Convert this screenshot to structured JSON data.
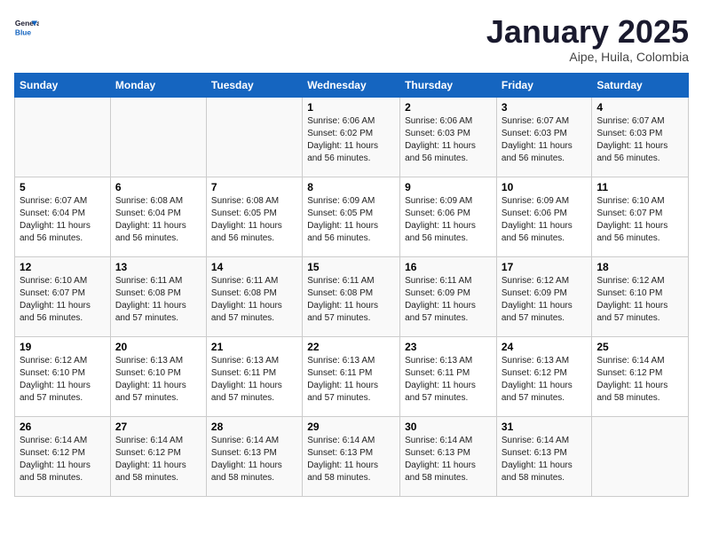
{
  "header": {
    "logo_line1": "General",
    "logo_line2": "Blue",
    "month": "January 2025",
    "location": "Aipe, Huila, Colombia"
  },
  "weekdays": [
    "Sunday",
    "Monday",
    "Tuesday",
    "Wednesday",
    "Thursday",
    "Friday",
    "Saturday"
  ],
  "weeks": [
    [
      {
        "day": "",
        "info": ""
      },
      {
        "day": "",
        "info": ""
      },
      {
        "day": "",
        "info": ""
      },
      {
        "day": "1",
        "info": "Sunrise: 6:06 AM\nSunset: 6:02 PM\nDaylight: 11 hours\nand 56 minutes."
      },
      {
        "day": "2",
        "info": "Sunrise: 6:06 AM\nSunset: 6:03 PM\nDaylight: 11 hours\nand 56 minutes."
      },
      {
        "day": "3",
        "info": "Sunrise: 6:07 AM\nSunset: 6:03 PM\nDaylight: 11 hours\nand 56 minutes."
      },
      {
        "day": "4",
        "info": "Sunrise: 6:07 AM\nSunset: 6:03 PM\nDaylight: 11 hours\nand 56 minutes."
      }
    ],
    [
      {
        "day": "5",
        "info": "Sunrise: 6:07 AM\nSunset: 6:04 PM\nDaylight: 11 hours\nand 56 minutes."
      },
      {
        "day": "6",
        "info": "Sunrise: 6:08 AM\nSunset: 6:04 PM\nDaylight: 11 hours\nand 56 minutes."
      },
      {
        "day": "7",
        "info": "Sunrise: 6:08 AM\nSunset: 6:05 PM\nDaylight: 11 hours\nand 56 minutes."
      },
      {
        "day": "8",
        "info": "Sunrise: 6:09 AM\nSunset: 6:05 PM\nDaylight: 11 hours\nand 56 minutes."
      },
      {
        "day": "9",
        "info": "Sunrise: 6:09 AM\nSunset: 6:06 PM\nDaylight: 11 hours\nand 56 minutes."
      },
      {
        "day": "10",
        "info": "Sunrise: 6:09 AM\nSunset: 6:06 PM\nDaylight: 11 hours\nand 56 minutes."
      },
      {
        "day": "11",
        "info": "Sunrise: 6:10 AM\nSunset: 6:07 PM\nDaylight: 11 hours\nand 56 minutes."
      }
    ],
    [
      {
        "day": "12",
        "info": "Sunrise: 6:10 AM\nSunset: 6:07 PM\nDaylight: 11 hours\nand 56 minutes."
      },
      {
        "day": "13",
        "info": "Sunrise: 6:11 AM\nSunset: 6:08 PM\nDaylight: 11 hours\nand 57 minutes."
      },
      {
        "day": "14",
        "info": "Sunrise: 6:11 AM\nSunset: 6:08 PM\nDaylight: 11 hours\nand 57 minutes."
      },
      {
        "day": "15",
        "info": "Sunrise: 6:11 AM\nSunset: 6:08 PM\nDaylight: 11 hours\nand 57 minutes."
      },
      {
        "day": "16",
        "info": "Sunrise: 6:11 AM\nSunset: 6:09 PM\nDaylight: 11 hours\nand 57 minutes."
      },
      {
        "day": "17",
        "info": "Sunrise: 6:12 AM\nSunset: 6:09 PM\nDaylight: 11 hours\nand 57 minutes."
      },
      {
        "day": "18",
        "info": "Sunrise: 6:12 AM\nSunset: 6:10 PM\nDaylight: 11 hours\nand 57 minutes."
      }
    ],
    [
      {
        "day": "19",
        "info": "Sunrise: 6:12 AM\nSunset: 6:10 PM\nDaylight: 11 hours\nand 57 minutes."
      },
      {
        "day": "20",
        "info": "Sunrise: 6:13 AM\nSunset: 6:10 PM\nDaylight: 11 hours\nand 57 minutes."
      },
      {
        "day": "21",
        "info": "Sunrise: 6:13 AM\nSunset: 6:11 PM\nDaylight: 11 hours\nand 57 minutes."
      },
      {
        "day": "22",
        "info": "Sunrise: 6:13 AM\nSunset: 6:11 PM\nDaylight: 11 hours\nand 57 minutes."
      },
      {
        "day": "23",
        "info": "Sunrise: 6:13 AM\nSunset: 6:11 PM\nDaylight: 11 hours\nand 57 minutes."
      },
      {
        "day": "24",
        "info": "Sunrise: 6:13 AM\nSunset: 6:12 PM\nDaylight: 11 hours\nand 57 minutes."
      },
      {
        "day": "25",
        "info": "Sunrise: 6:14 AM\nSunset: 6:12 PM\nDaylight: 11 hours\nand 58 minutes."
      }
    ],
    [
      {
        "day": "26",
        "info": "Sunrise: 6:14 AM\nSunset: 6:12 PM\nDaylight: 11 hours\nand 58 minutes."
      },
      {
        "day": "27",
        "info": "Sunrise: 6:14 AM\nSunset: 6:12 PM\nDaylight: 11 hours\nand 58 minutes."
      },
      {
        "day": "28",
        "info": "Sunrise: 6:14 AM\nSunset: 6:13 PM\nDaylight: 11 hours\nand 58 minutes."
      },
      {
        "day": "29",
        "info": "Sunrise: 6:14 AM\nSunset: 6:13 PM\nDaylight: 11 hours\nand 58 minutes."
      },
      {
        "day": "30",
        "info": "Sunrise: 6:14 AM\nSunset: 6:13 PM\nDaylight: 11 hours\nand 58 minutes."
      },
      {
        "day": "31",
        "info": "Sunrise: 6:14 AM\nSunset: 6:13 PM\nDaylight: 11 hours\nand 58 minutes."
      },
      {
        "day": "",
        "info": ""
      }
    ]
  ]
}
